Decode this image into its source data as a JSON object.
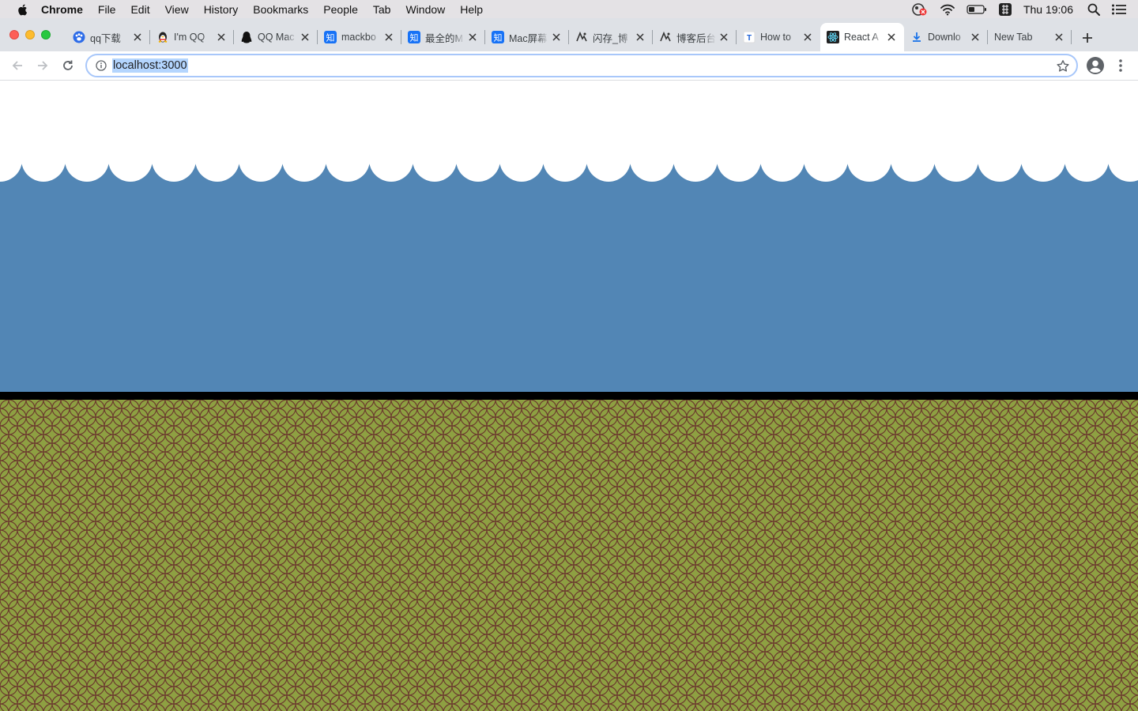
{
  "menubar": {
    "app_name": "Chrome",
    "items": [
      "File",
      "Edit",
      "View",
      "History",
      "Bookmarks",
      "People",
      "Tab",
      "Window",
      "Help"
    ],
    "clock": "Thu 19:06"
  },
  "tabs": [
    {
      "title": "qq下载",
      "icon": "paw-icon"
    },
    {
      "title": "I'm QQ",
      "icon": "penguin-icon"
    },
    {
      "title": "QQ Mac",
      "icon": "penguin-black-icon"
    },
    {
      "title": "mackbo",
      "icon": "zhihu-icon"
    },
    {
      "title": "最全的M",
      "icon": "zhihu-icon"
    },
    {
      "title": "Mac屏幕",
      "icon": "zhihu-icon"
    },
    {
      "title": "闪存_博",
      "icon": "cnblogs-icon"
    },
    {
      "title": "博客后台",
      "icon": "cnblogs-icon"
    },
    {
      "title": "How to",
      "icon": "t-icon"
    },
    {
      "title": "React A",
      "icon": "react-icon",
      "active": true
    },
    {
      "title": "Downlo",
      "icon": "download-icon"
    },
    {
      "title": "New Tab",
      "icon": ""
    }
  ],
  "address_bar": {
    "url": "localhost:3000"
  },
  "colors": {
    "sky": "#ffffff",
    "sea": "#5286b5",
    "shore": "#000000",
    "ground": "#8ea042",
    "ground_scale_stroke": "#6b3a2e"
  }
}
